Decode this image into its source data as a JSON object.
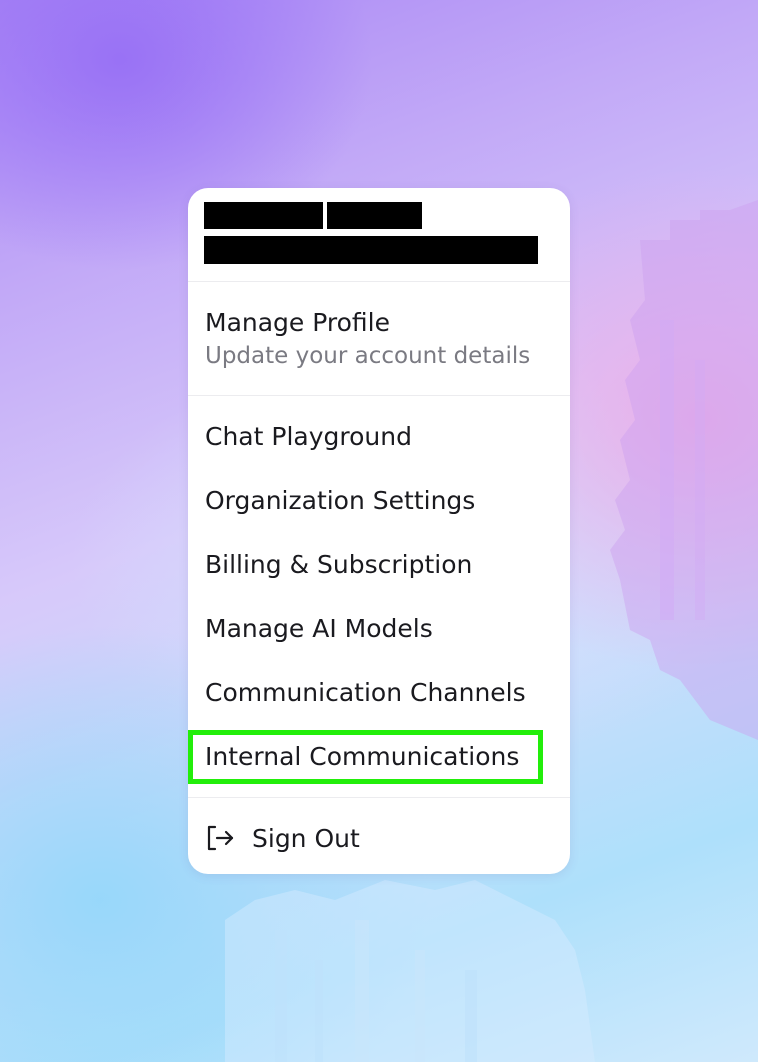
{
  "account": {
    "name": "",
    "email": ""
  },
  "profile": {
    "title": "Manage Profile",
    "subtitle": "Update your account details"
  },
  "menu": {
    "items": [
      {
        "label": "Chat Playground"
      },
      {
        "label": "Organization Settings"
      },
      {
        "label": "Billing & Subscription"
      },
      {
        "label": "Manage AI Models"
      },
      {
        "label": "Communication Channels"
      },
      {
        "label": "Internal Communications"
      }
    ],
    "highlighted_item": "Internal Communications",
    "highlight_color": "#22ee0a"
  },
  "sign_out": {
    "label": "Sign Out",
    "icon": "sign-out-icon"
  }
}
